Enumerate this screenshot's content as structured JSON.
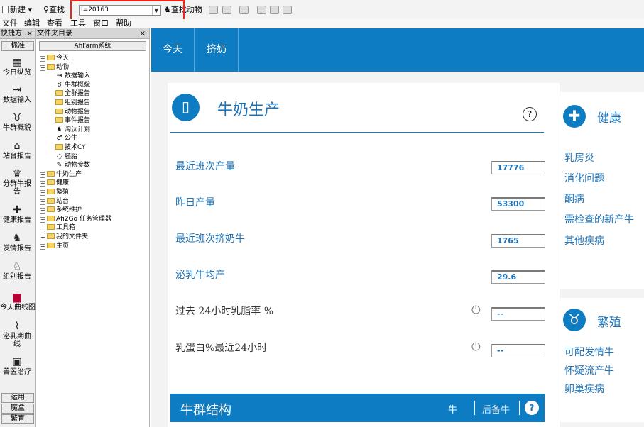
{
  "toolbar": {
    "new_label": "新建 ▾",
    "find_label": "查找",
    "find_value": "I=20163",
    "find_animal_label": "查找动物"
  },
  "menubar": {
    "items": [
      "文件",
      "编辑",
      "查看",
      "工具",
      "窗口",
      "帮助"
    ]
  },
  "left_panel": {
    "title": "快捷方...",
    "close": "×",
    "tab_top": "标准",
    "items": [
      {
        "label": "今日纵览",
        "icon": "overview-icon"
      },
      {
        "label": "数据输入",
        "icon": "data-entry-icon"
      },
      {
        "label": "牛群概貌",
        "icon": "herd-overview-icon"
      },
      {
        "label": "站台报告",
        "icon": "station-report-icon"
      },
      {
        "label": "分群牛报告",
        "icon": "group-report-icon"
      },
      {
        "label": "健康报告",
        "icon": "health-report-icon"
      },
      {
        "label": "发情报告",
        "icon": "heat-report-icon"
      },
      {
        "label": "组别报告",
        "icon": "pen-report-icon"
      },
      {
        "label": "今天曲线图",
        "icon": "chart-icon"
      },
      {
        "label": "泌乳期曲线",
        "icon": "lactation-curve-icon"
      },
      {
        "label": "兽医治疗",
        "icon": "vet-treatment-icon"
      }
    ],
    "bottom_tabs": [
      "运用",
      "魔盒",
      "繁育"
    ]
  },
  "folder_panel": {
    "title": "文件夹目录",
    "close": "×",
    "root": "AfiFarm系统",
    "tree": [
      {
        "label": "今天",
        "level": 0,
        "expander": "+",
        "icon": "folder"
      },
      {
        "label": "动物",
        "level": 0,
        "expander": "−",
        "icon": "folder-open"
      },
      {
        "label": "数据输入",
        "level": 1,
        "icon": "data-entry"
      },
      {
        "label": "牛群概貌",
        "level": 1,
        "icon": "herd"
      },
      {
        "label": "全群报告",
        "level": 1,
        "icon": "folder"
      },
      {
        "label": "组别报告",
        "level": 1,
        "icon": "folder"
      },
      {
        "label": "动物报告",
        "level": 1,
        "icon": "folder"
      },
      {
        "label": "事件报告",
        "level": 1,
        "icon": "folder"
      },
      {
        "label": "淘汰计划",
        "level": 1,
        "icon": "cull"
      },
      {
        "label": "公牛",
        "level": 1,
        "icon": "bull"
      },
      {
        "label": "技术CY",
        "level": 1,
        "icon": "folder"
      },
      {
        "label": "胚胎",
        "level": 1,
        "icon": "embryo"
      },
      {
        "label": "动物参数",
        "level": 1,
        "icon": "params"
      },
      {
        "label": "牛奶生产",
        "level": 0,
        "expander": "+",
        "icon": "folder"
      },
      {
        "label": "健康",
        "level": 0,
        "expander": "+",
        "icon": "folder"
      },
      {
        "label": "繁殖",
        "level": 0,
        "expander": "+",
        "icon": "folder"
      },
      {
        "label": "站台",
        "level": 0,
        "expander": "+",
        "icon": "folder"
      },
      {
        "label": "系统维护",
        "level": 0,
        "expander": "+",
        "icon": "folder"
      },
      {
        "label": "Afi2Go 任务管理器",
        "level": 0,
        "expander": "+",
        "icon": "folder"
      },
      {
        "label": "工具箱",
        "level": 0,
        "expander": "+",
        "icon": "folder"
      },
      {
        "label": "我的文件夹",
        "level": 0,
        "expander": "+",
        "icon": "folder"
      },
      {
        "label": "主页",
        "level": 0,
        "expander": "+",
        "icon": "folder"
      }
    ]
  },
  "main": {
    "tabs": [
      "今天",
      "挤奶"
    ],
    "milk_card": {
      "title": "牛奶生产",
      "help": "?",
      "metrics": [
        {
          "label": "最近班次产量",
          "value": "17776"
        },
        {
          "label": "昨日产量",
          "value": "53300"
        },
        {
          "label": "最近班次挤奶牛",
          "value": "1765"
        },
        {
          "label": "泌乳牛均产",
          "value": "29.6"
        },
        {
          "label": "过去 24小时乳脂率 %",
          "value": "--"
        },
        {
          "label": "乳蛋白%最近24小时",
          "value": "--"
        }
      ]
    },
    "herd_structure": {
      "title": "牛群结构",
      "col1": "牛",
      "col2": "后备牛",
      "help": "?"
    },
    "health_card": {
      "title": "健康",
      "links": [
        "乳房炎",
        "消化问题",
        "酮病",
        "需检查的新产牛",
        "其他疾病"
      ]
    },
    "repro_card": {
      "title": "繁殖",
      "links": [
        "可配发情牛",
        "怀疑流产牛",
        "卵巢疾病"
      ]
    }
  },
  "colors": {
    "brand_blue": "#0d7cc3",
    "link_blue": "#1f74b8",
    "highlight_red": "#e8261f"
  }
}
